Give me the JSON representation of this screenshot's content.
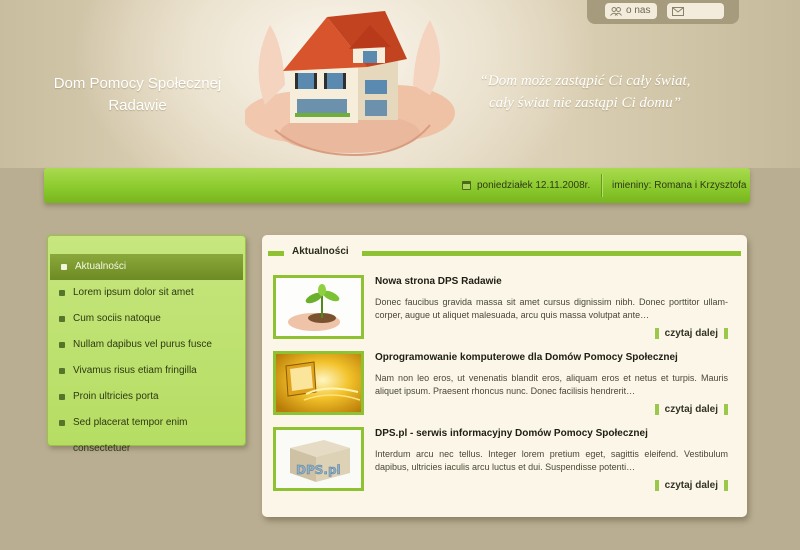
{
  "top_bar": {
    "about_label": "o nas",
    "about_icon": "people-icon",
    "contact_icon": "envelope-icon"
  },
  "header": {
    "title_line1": "Dom Pomocy Społecznej",
    "title_line2": "Radawie",
    "motto_line1": "“Dom może zastąpić Ci cały świat,",
    "motto_line2": "cały świat nie zastąpi Ci domu”"
  },
  "date_bar": {
    "date": "poniedziałek 12.11.2008r.",
    "name_days": "imieniny: Romana i Krzysztofa"
  },
  "menu": {
    "items": [
      {
        "label": "Aktualności",
        "active": true
      },
      {
        "label": "Lorem ipsum dolor sit amet"
      },
      {
        "label": "Cum sociis natoque"
      },
      {
        "label": "Nullam dapibus vel purus fusce"
      },
      {
        "label": "Vivamus risus etiam fringilla"
      },
      {
        "label": "Proin ultricies porta"
      },
      {
        "label": "Sed placerat tempor enim consectetuer"
      }
    ]
  },
  "content": {
    "title": "Aktualności",
    "news": [
      {
        "title": "Nowa strona DPS Radawie",
        "text": "Donec faucibus gravida massa sit amet cursus dignissim nibh. Donec porttitor ullam-corper, augue ut aliquet malesuada, arcu quis massa volutpat ante…",
        "more": "czytaj dalej"
      },
      {
        "title": "Oprogramowanie komputerowe dla Domów Pomocy Społecznej",
        "text": "Nam non leo eros, ut venenatis blandit eros, aliquam eros et netus et turpis. Mauris aliquet ipsum. Praesent rhoncus nunc. Donec facilisis hendrerit…",
        "more": "czytaj dalej"
      },
      {
        "title": "DPS.pl - serwis informacyjny Domów Pomocy Społecznej",
        "text": "Interdum arcu nec tellus. Integer lorem pretium eget, sagittis eleifend. Vestibulum dapibus, ultricies iaculis arcu luctus et dui. Suspendisse potenti…",
        "more": "czytaj dalej",
        "thumb_text": "DPS.pl"
      }
    ]
  },
  "colors": {
    "accent": "#8fc233",
    "background": "#b9ad92",
    "menu": "#c6e67e"
  }
}
